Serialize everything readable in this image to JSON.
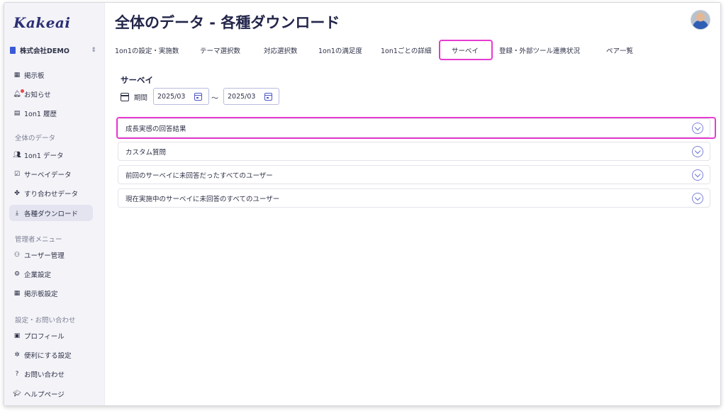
{
  "app": {
    "logo": "Kakeai",
    "company": "株式会社DEMO"
  },
  "sidebar": {
    "items_top": [
      {
        "label": "掲示板",
        "icon": "board-icon"
      },
      {
        "label": "お知らせ",
        "icon": "bell-icon"
      },
      {
        "label": "1on1 履歴",
        "icon": "history-icon"
      }
    ],
    "section_all": "全体のデータ",
    "items_all": [
      {
        "label": "1on1 データ",
        "icon": "people-icon"
      },
      {
        "label": "サーベイデータ",
        "icon": "checkbox-icon"
      },
      {
        "label": "すり合わせデータ",
        "icon": "puzzle-icon"
      },
      {
        "label": "各種ダウンロード",
        "icon": "download-icon"
      }
    ],
    "section_admin": "管理者メニュー",
    "items_admin": [
      {
        "label": "ユーザー管理",
        "icon": "user-manage-icon"
      },
      {
        "label": "企業設定",
        "icon": "company-settings-icon"
      },
      {
        "label": "掲示板設定",
        "icon": "board-settings-icon"
      }
    ],
    "section_settings": "設定・お問い合わせ",
    "items_settings": [
      {
        "label": "プロフィール",
        "icon": "profile-icon"
      },
      {
        "label": "便利にする設定",
        "icon": "gear-icon"
      },
      {
        "label": "お問い合わせ",
        "icon": "help-icon"
      },
      {
        "label": "ヘルプページ",
        "icon": "graduation-cap-icon"
      }
    ]
  },
  "main": {
    "title": "全体のデータ - 各種ダウンロード",
    "tabs": [
      "1on1の設定・実施数",
      "テーマ選択数",
      "対応選択数",
      "1on1の満足度",
      "1on1ごとの詳細",
      "サーベイ",
      "登録・外部ツール連携状況",
      "ペア一覧"
    ],
    "active_tab": "サーベイ",
    "section_title": "サーベイ",
    "period_label": "期間",
    "date_from": "2025/03",
    "date_to": "2025/03",
    "tilde": "〜",
    "accordions": [
      "成長実感の回答結果",
      "カスタム質問",
      "前回のサーベイに未回答だったすべてのユーザー",
      "現在実施中のサーベイに未回答のすべてのユーザー"
    ]
  },
  "colors": {
    "highlight": "#e63bd0",
    "accent": "#6f6ad8",
    "sidebar_bg": "#f3f3f8"
  }
}
